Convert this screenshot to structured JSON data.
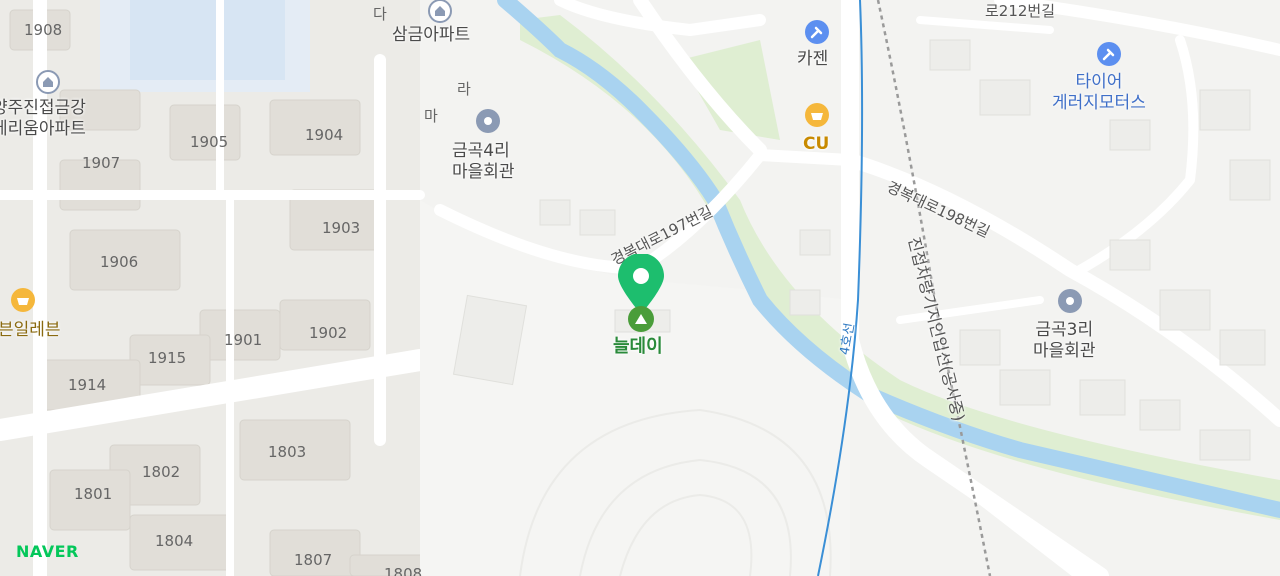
{
  "map": {
    "brand": "NAVER",
    "selected_place": {
      "name": "늘데이"
    },
    "pois": [
      {
        "id": "samgeum",
        "name": "삼금아파트"
      },
      {
        "id": "hall4",
        "name": "금곡4리\n마을회관"
      },
      {
        "id": "kajen",
        "name": "카젠"
      },
      {
        "id": "cu",
        "name": "CU"
      },
      {
        "id": "tire",
        "name": "타이어\n게러지모터스"
      },
      {
        "id": "hall3",
        "name": "금곡3리\n마을회관"
      },
      {
        "id": "seven",
        "name": "븐일레븐"
      },
      {
        "id": "apt",
        "name": "양주진접금강\n테리움아파트"
      }
    ],
    "roads": [
      {
        "id": "r197",
        "name": "경복대로197번길"
      },
      {
        "id": "r198",
        "name": "경복대로198번길"
      },
      {
        "id": "r212",
        "name": "로212번길"
      },
      {
        "id": "line4",
        "name": "4호선"
      },
      {
        "id": "depot",
        "name": "진접차량기지인입선(공사중)"
      }
    ],
    "buildings": [
      "1908",
      "1904",
      "1905",
      "1907",
      "1903",
      "1906",
      "1902",
      "1901",
      "1915",
      "1914",
      "1803",
      "1802",
      "1801",
      "1804",
      "1807",
      "1808"
    ],
    "small_labels": [
      "다",
      "라",
      "마"
    ],
    "colors": {
      "water": "#a9d3f0",
      "park": "#d8ecc6",
      "pin": "#1dbe6e",
      "poi_gray": "#8b9ab4",
      "poi_yellow": "#f5b73b",
      "poi_blue": "#5c8ff0",
      "rail": "#3a8fd6"
    }
  }
}
